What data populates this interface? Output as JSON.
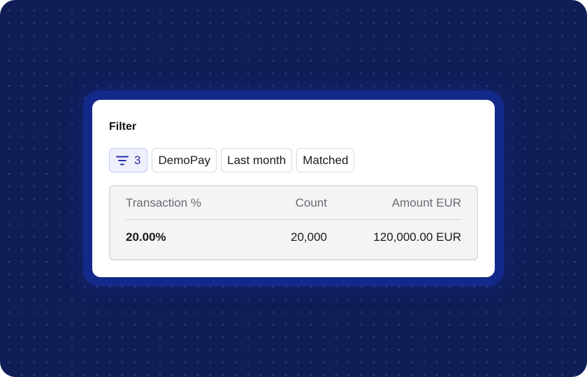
{
  "panel": {
    "title": "Filter"
  },
  "filters": {
    "count": "3",
    "chips": [
      "DemoPay",
      "Last month",
      "Matched"
    ]
  },
  "table": {
    "headers": [
      "Transaction %",
      "Count",
      "Amount EUR"
    ],
    "rows": [
      [
        "20.00%",
        "20,000",
        "120,000.00 EUR"
      ]
    ]
  },
  "colors": {
    "background": "#101e57",
    "accent": "#2530a6",
    "card": "#ffffff"
  },
  "icons": {
    "filter": "filter-funnel-lines-icon"
  }
}
